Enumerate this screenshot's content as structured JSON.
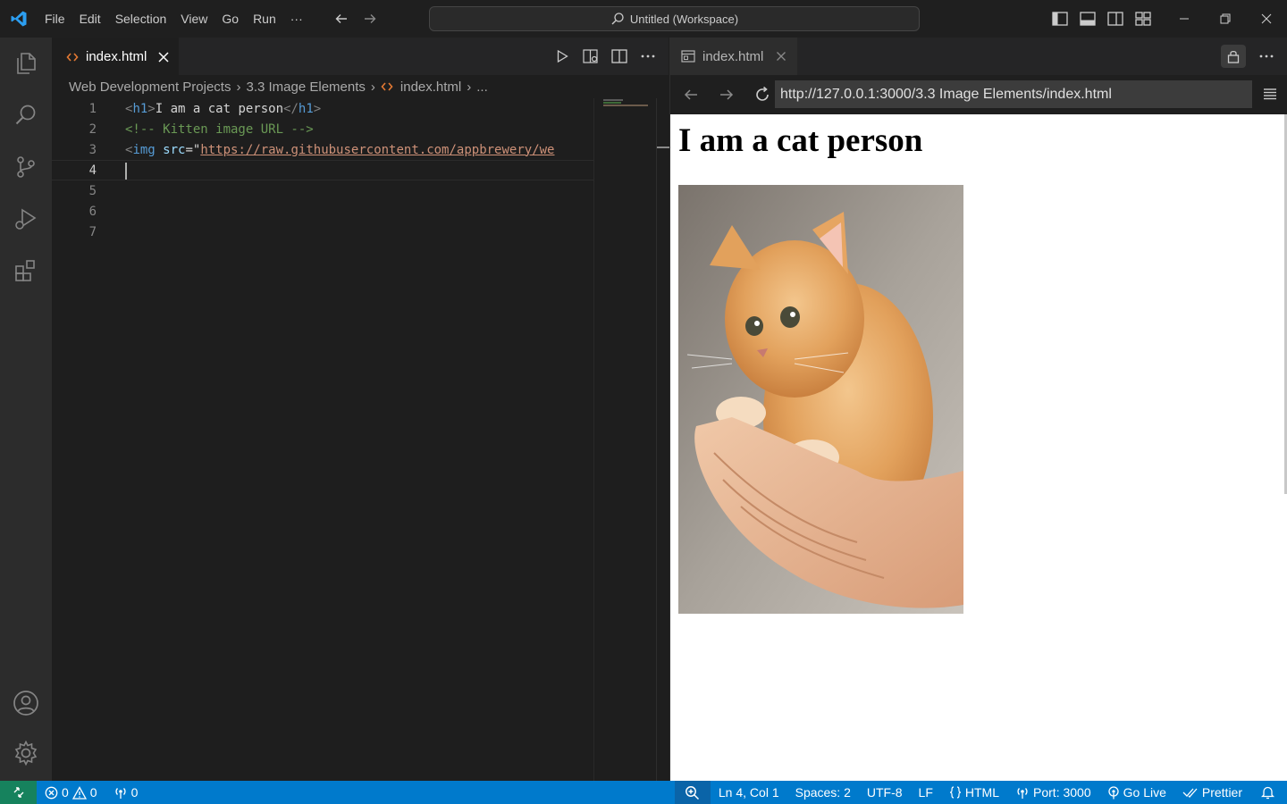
{
  "titlebar": {
    "menu": [
      "File",
      "Edit",
      "Selection",
      "View",
      "Go",
      "Run",
      "···"
    ],
    "command_center": "Untitled (Workspace)"
  },
  "editor": {
    "tab_label": "index.html",
    "breadcrumb": [
      "Web Development Projects",
      "3.3 Image Elements",
      "index.html",
      "..."
    ],
    "line_numbers": [
      "1",
      "2",
      "3",
      "4",
      "5",
      "6",
      "7"
    ],
    "active_line": 4,
    "lines": [
      {
        "tag_open": "<",
        "tag": "h1",
        "tag_close": ">",
        "text": "I am a cat person",
        "end_open": "</",
        "end_tag": "h1",
        "end_close": ">"
      },
      {
        "comment": "<!-- Kitten image URL -->"
      },
      {
        "tag_open": "<",
        "tag": "img",
        "attr": "src",
        "eq": "=\"",
        "value": "https://raw.githubusercontent.com/appbrewery/we"
      }
    ]
  },
  "preview": {
    "tab_label": "index.html",
    "url": "http://127.0.0.1:3000/3.3 Image Elements/index.html",
    "heading": "I am a cat person"
  },
  "statusbar": {
    "errors": "0",
    "warnings": "0",
    "ports": "0",
    "position": "Ln 4, Col 1",
    "spaces": "Spaces: 2",
    "encoding": "UTF-8",
    "eol": "LF",
    "language": "HTML",
    "port": "Port: 3000",
    "golive": "Go Live",
    "prettier": "Prettier"
  },
  "colors": {
    "accent": "#007acc",
    "remote": "#16825d",
    "html_icon": "#e37933"
  }
}
